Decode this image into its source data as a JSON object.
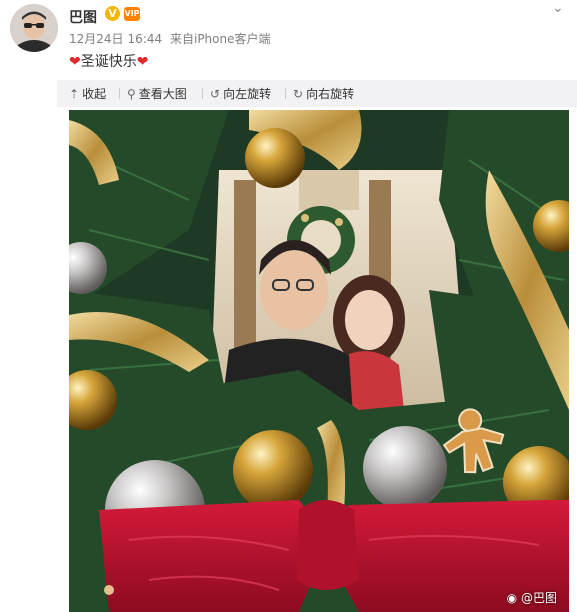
{
  "post": {
    "username": "巴图",
    "verified_badge": "V",
    "vip_badge": "VIP",
    "date": "12月24日",
    "time": "16:44",
    "source_prefix": "来自",
    "source": "iPhone客户端",
    "heart_left": "❤",
    "text": "圣诞快乐",
    "heart_right": "❤"
  },
  "toolbar": {
    "collapse": "收起",
    "view_large": "查看大图",
    "rotate_left": "向左旋转",
    "rotate_right": "向右旋转",
    "icons": [
      "collapse-icon",
      "magnifier-icon",
      "rotate-left-icon",
      "rotate-right-icon"
    ]
  },
  "image": {
    "watermark": "@巴图"
  },
  "colors": {
    "verified": "#f7b500",
    "vip": "#ff8200",
    "heart": "#e0282d",
    "toolbar_bg": "#f2f2f5"
  }
}
